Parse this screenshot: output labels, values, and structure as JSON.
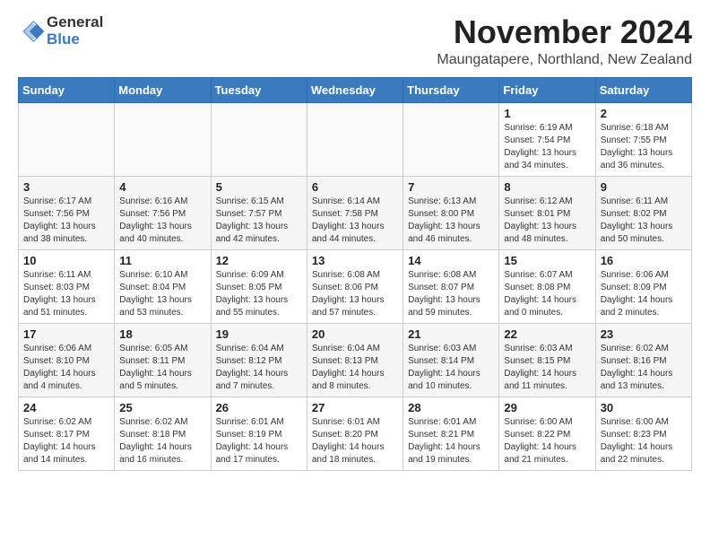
{
  "header": {
    "logo_general": "General",
    "logo_blue": "Blue",
    "month": "November 2024",
    "location": "Maungatapere, Northland, New Zealand"
  },
  "days_of_week": [
    "Sunday",
    "Monday",
    "Tuesday",
    "Wednesday",
    "Thursday",
    "Friday",
    "Saturday"
  ],
  "weeks": [
    [
      {
        "day": "",
        "sunrise": "",
        "sunset": "",
        "daylight": ""
      },
      {
        "day": "",
        "sunrise": "",
        "sunset": "",
        "daylight": ""
      },
      {
        "day": "",
        "sunrise": "",
        "sunset": "",
        "daylight": ""
      },
      {
        "day": "",
        "sunrise": "",
        "sunset": "",
        "daylight": ""
      },
      {
        "day": "",
        "sunrise": "",
        "sunset": "",
        "daylight": ""
      },
      {
        "day": "1",
        "sunrise": "Sunrise: 6:19 AM",
        "sunset": "Sunset: 7:54 PM",
        "daylight": "Daylight: 13 hours and 34 minutes."
      },
      {
        "day": "2",
        "sunrise": "Sunrise: 6:18 AM",
        "sunset": "Sunset: 7:55 PM",
        "daylight": "Daylight: 13 hours and 36 minutes."
      }
    ],
    [
      {
        "day": "3",
        "sunrise": "Sunrise: 6:17 AM",
        "sunset": "Sunset: 7:56 PM",
        "daylight": "Daylight: 13 hours and 38 minutes."
      },
      {
        "day": "4",
        "sunrise": "Sunrise: 6:16 AM",
        "sunset": "Sunset: 7:56 PM",
        "daylight": "Daylight: 13 hours and 40 minutes."
      },
      {
        "day": "5",
        "sunrise": "Sunrise: 6:15 AM",
        "sunset": "Sunset: 7:57 PM",
        "daylight": "Daylight: 13 hours and 42 minutes."
      },
      {
        "day": "6",
        "sunrise": "Sunrise: 6:14 AM",
        "sunset": "Sunset: 7:58 PM",
        "daylight": "Daylight: 13 hours and 44 minutes."
      },
      {
        "day": "7",
        "sunrise": "Sunrise: 6:13 AM",
        "sunset": "Sunset: 8:00 PM",
        "daylight": "Daylight: 13 hours and 46 minutes."
      },
      {
        "day": "8",
        "sunrise": "Sunrise: 6:12 AM",
        "sunset": "Sunset: 8:01 PM",
        "daylight": "Daylight: 13 hours and 48 minutes."
      },
      {
        "day": "9",
        "sunrise": "Sunrise: 6:11 AM",
        "sunset": "Sunset: 8:02 PM",
        "daylight": "Daylight: 13 hours and 50 minutes."
      }
    ],
    [
      {
        "day": "10",
        "sunrise": "Sunrise: 6:11 AM",
        "sunset": "Sunset: 8:03 PM",
        "daylight": "Daylight: 13 hours and 51 minutes."
      },
      {
        "day": "11",
        "sunrise": "Sunrise: 6:10 AM",
        "sunset": "Sunset: 8:04 PM",
        "daylight": "Daylight: 13 hours and 53 minutes."
      },
      {
        "day": "12",
        "sunrise": "Sunrise: 6:09 AM",
        "sunset": "Sunset: 8:05 PM",
        "daylight": "Daylight: 13 hours and 55 minutes."
      },
      {
        "day": "13",
        "sunrise": "Sunrise: 6:08 AM",
        "sunset": "Sunset: 8:06 PM",
        "daylight": "Daylight: 13 hours and 57 minutes."
      },
      {
        "day": "14",
        "sunrise": "Sunrise: 6:08 AM",
        "sunset": "Sunset: 8:07 PM",
        "daylight": "Daylight: 13 hours and 59 minutes."
      },
      {
        "day": "15",
        "sunrise": "Sunrise: 6:07 AM",
        "sunset": "Sunset: 8:08 PM",
        "daylight": "Daylight: 14 hours and 0 minutes."
      },
      {
        "day": "16",
        "sunrise": "Sunrise: 6:06 AM",
        "sunset": "Sunset: 8:09 PM",
        "daylight": "Daylight: 14 hours and 2 minutes."
      }
    ],
    [
      {
        "day": "17",
        "sunrise": "Sunrise: 6:06 AM",
        "sunset": "Sunset: 8:10 PM",
        "daylight": "Daylight: 14 hours and 4 minutes."
      },
      {
        "day": "18",
        "sunrise": "Sunrise: 6:05 AM",
        "sunset": "Sunset: 8:11 PM",
        "daylight": "Daylight: 14 hours and 5 minutes."
      },
      {
        "day": "19",
        "sunrise": "Sunrise: 6:04 AM",
        "sunset": "Sunset: 8:12 PM",
        "daylight": "Daylight: 14 hours and 7 minutes."
      },
      {
        "day": "20",
        "sunrise": "Sunrise: 6:04 AM",
        "sunset": "Sunset: 8:13 PM",
        "daylight": "Daylight: 14 hours and 8 minutes."
      },
      {
        "day": "21",
        "sunrise": "Sunrise: 6:03 AM",
        "sunset": "Sunset: 8:14 PM",
        "daylight": "Daylight: 14 hours and 10 minutes."
      },
      {
        "day": "22",
        "sunrise": "Sunrise: 6:03 AM",
        "sunset": "Sunset: 8:15 PM",
        "daylight": "Daylight: 14 hours and 11 minutes."
      },
      {
        "day": "23",
        "sunrise": "Sunrise: 6:02 AM",
        "sunset": "Sunset: 8:16 PM",
        "daylight": "Daylight: 14 hours and 13 minutes."
      }
    ],
    [
      {
        "day": "24",
        "sunrise": "Sunrise: 6:02 AM",
        "sunset": "Sunset: 8:17 PM",
        "daylight": "Daylight: 14 hours and 14 minutes."
      },
      {
        "day": "25",
        "sunrise": "Sunrise: 6:02 AM",
        "sunset": "Sunset: 8:18 PM",
        "daylight": "Daylight: 14 hours and 16 minutes."
      },
      {
        "day": "26",
        "sunrise": "Sunrise: 6:01 AM",
        "sunset": "Sunset: 8:19 PM",
        "daylight": "Daylight: 14 hours and 17 minutes."
      },
      {
        "day": "27",
        "sunrise": "Sunrise: 6:01 AM",
        "sunset": "Sunset: 8:20 PM",
        "daylight": "Daylight: 14 hours and 18 minutes."
      },
      {
        "day": "28",
        "sunrise": "Sunrise: 6:01 AM",
        "sunset": "Sunset: 8:21 PM",
        "daylight": "Daylight: 14 hours and 19 minutes."
      },
      {
        "day": "29",
        "sunrise": "Sunrise: 6:00 AM",
        "sunset": "Sunset: 8:22 PM",
        "daylight": "Daylight: 14 hours and 21 minutes."
      },
      {
        "day": "30",
        "sunrise": "Sunrise: 6:00 AM",
        "sunset": "Sunset: 8:23 PM",
        "daylight": "Daylight: 14 hours and 22 minutes."
      }
    ]
  ]
}
